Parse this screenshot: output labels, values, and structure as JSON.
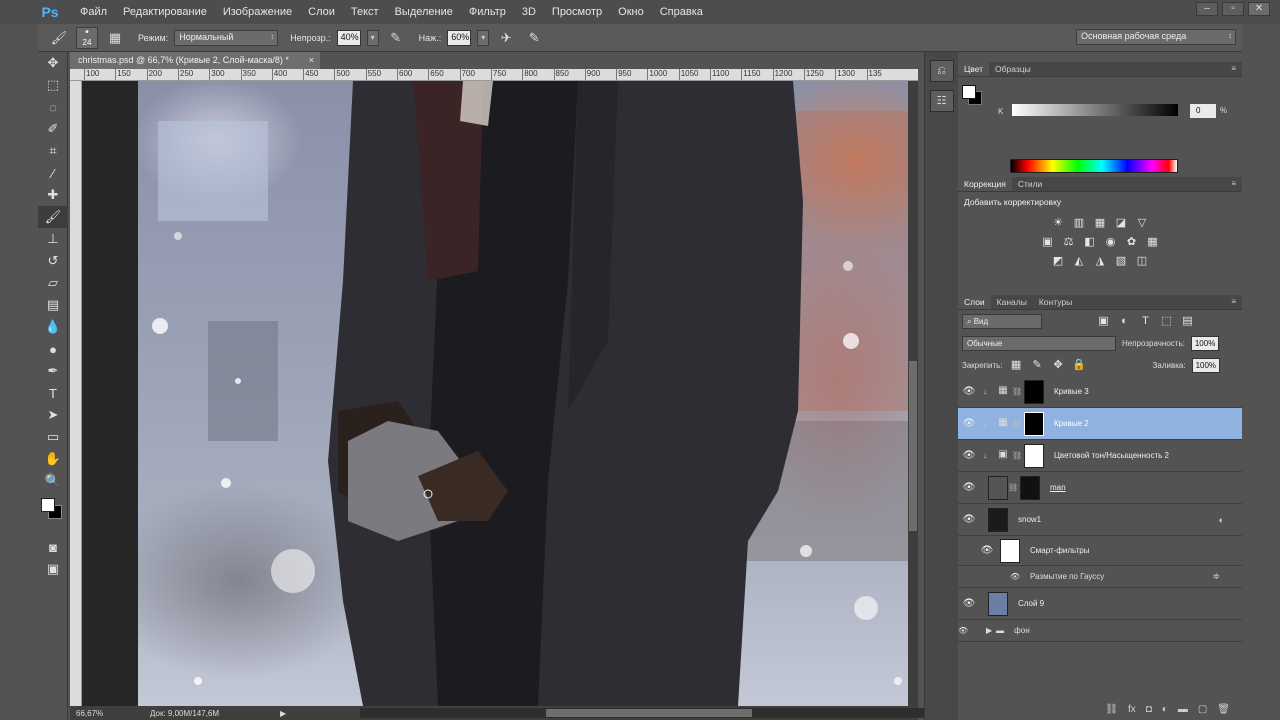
{
  "menu": {
    "logo": "Ps",
    "items": [
      "Файл",
      "Редактирование",
      "Изображение",
      "Слои",
      "Текст",
      "Выделение",
      "Фильтр",
      "3D",
      "Просмотр",
      "Окно",
      "Справка"
    ]
  },
  "window": {
    "minimize": "–",
    "restore": "▫",
    "close": "✕"
  },
  "options": {
    "brush_size": "24",
    "mode_label": "Режим:",
    "mode_value": "Нормальный",
    "opacity_label": "Непрозр.:",
    "opacity_value": "40%",
    "flow_label": "Наж.:",
    "flow_value": "60%",
    "workspace": "Основная рабочая среда"
  },
  "document": {
    "tab_title": "christmas.psd @ 66,7% (Кривые 2, Слой-маска/8) *",
    "ruler_ticks": [
      "100",
      "150",
      "200",
      "250",
      "300",
      "350",
      "400",
      "450",
      "500",
      "550",
      "600",
      "650",
      "700",
      "750",
      "800",
      "850",
      "900",
      "950",
      "1000",
      "1050",
      "1100",
      "1150",
      "1200",
      "1250",
      "1300",
      "135"
    ],
    "zoom": "66,67%",
    "doc_size": "Док: 9,00M/147,6M"
  },
  "color_panel": {
    "tabs": [
      "Цвет",
      "Образцы"
    ],
    "channel_label": "K",
    "channel_value": "0",
    "percent": "%"
  },
  "adjustments_panel": {
    "tabs": [
      "Коррекция",
      "Стили"
    ],
    "title": "Добавить корректировку"
  },
  "layers_panel": {
    "tabs": [
      "Слои",
      "Каналы",
      "Контуры"
    ],
    "filter": "Вид",
    "blend_mode": "Обычные",
    "opacity_label": "Непрозрачность:",
    "opacity_value": "100%",
    "lock_label": "Закрепить:",
    "fill_label": "Заливка:",
    "fill_value": "100%",
    "layers": [
      {
        "name": "Кривые 3",
        "selected": false
      },
      {
        "name": "Кривые 2",
        "selected": true
      },
      {
        "name": "Цветовой тон/Насыщенность 2",
        "selected": false
      },
      {
        "name": "man",
        "selected": false
      },
      {
        "name": "snow1",
        "selected": false
      },
      {
        "name": "Смарт-фильтры",
        "selected": false
      },
      {
        "name": "Размытие по Гауссу",
        "selected": false
      },
      {
        "name": "Слой 9",
        "selected": false
      },
      {
        "name": "фон",
        "selected": false
      }
    ]
  },
  "colors": {
    "selection": "#8fb3de",
    "ps_blue": "#4fb3ff"
  }
}
